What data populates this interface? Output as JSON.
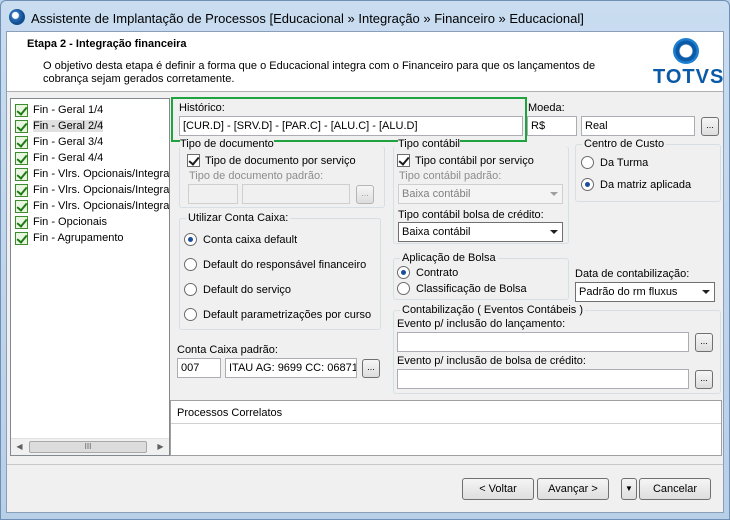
{
  "window": {
    "title": "Assistente de Implantação de Processos [Educacional » Integração » Financeiro » Educacional]"
  },
  "header": {
    "step_title": "Etapa 2 - Integração financeira",
    "description": "O objetivo desta etapa é definir a forma que o Educacional integra com o Financeiro para que os lançamentos de cobrança sejam gerados corretamente.",
    "logo_text": "TOTVS"
  },
  "tree": {
    "items": [
      {
        "label": "Fin - Geral 1/4"
      },
      {
        "label": "Fin - Geral 2/4"
      },
      {
        "label": "Fin - Geral 3/4"
      },
      {
        "label": "Fin - Geral 4/4"
      },
      {
        "label": "Fin - Vlrs. Opcionais/Integra"
      },
      {
        "label": "Fin - Vlrs. Opcionais/Integra"
      },
      {
        "label": "Fin - Vlrs. Opcionais/Integra"
      },
      {
        "label": "Fin - Opcionais"
      },
      {
        "label": "Fin - Agrupamento"
      }
    ],
    "scroll_thumb": "III"
  },
  "historico": {
    "label": "Histórico:",
    "value": "[CUR.D] - [SRV.D] - [PAR.C] - [ALU.C] - [ALU.D]"
  },
  "moeda": {
    "label": "Moeda:",
    "symbol": "R$",
    "name": "Real",
    "lookup": "..."
  },
  "tipo_documento": {
    "legend": "Tipo de documento",
    "checkbox_label": "Tipo de documento por serviço",
    "padrao_label": "Tipo de documento padrão:",
    "lookup": "..."
  },
  "tipo_contabil": {
    "legend": "Tipo contábil",
    "checkbox_label": "Tipo contábil por serviço",
    "padrao_label": "Tipo contábil padrão:",
    "padrao_value": "Baixa contábil",
    "bolsa_label": "Tipo contábil bolsa de crédito:",
    "bolsa_value": "Baixa contábil"
  },
  "centro_custo": {
    "legend": "Centro de Custo",
    "options": [
      "Da Turma",
      "Da matriz aplicada"
    ]
  },
  "conta_caixa": {
    "legend": "Utilizar Conta Caixa:",
    "options": [
      "Conta caixa default",
      "Default do responsável financeiro",
      "Default do serviço",
      "Default parametrizações por curso"
    ],
    "padrao_label": "Conta Caixa padrão:",
    "code": "007",
    "description": "ITAU AG: 9699 CC: 06871",
    "lookup": "..."
  },
  "aplicacao_bolsa": {
    "legend": "Aplicação de Bolsa",
    "options": [
      "Contrato",
      "Classificação de Bolsa"
    ]
  },
  "data_contabilizacao": {
    "label": "Data de contabilização:",
    "value": "Padrão do rm fluxus"
  },
  "contabilizacao": {
    "legend": "Contabilização ( Eventos Contábeis )",
    "evento_lancamento_label": "Evento p/ inclusão do lançamento:",
    "evento_bolsa_label": "Evento p/ inclusão de bolsa de crédito:",
    "lookup": "..."
  },
  "processos_correlatos": {
    "title": "Processos Correlatos"
  },
  "footer": {
    "voltar": "< Voltar",
    "avancar": "Avançar >",
    "cancelar": "Cancelar",
    "menu_caret": "▼"
  },
  "colors": {
    "highlight": "#1ea33e",
    "logo_blue": "#0b5aa7"
  }
}
